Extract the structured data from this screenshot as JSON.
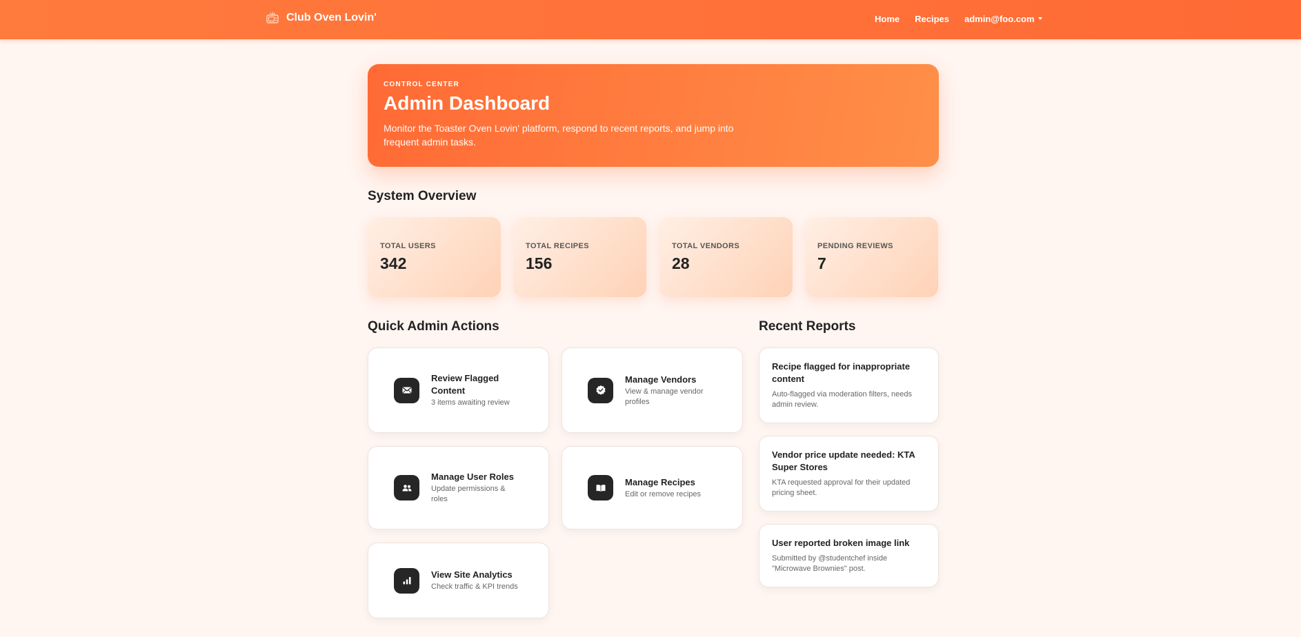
{
  "navbar": {
    "brand": "Club Oven Lovin'",
    "links": [
      "Home",
      "Recipes"
    ],
    "user": "admin@foo.com"
  },
  "hero": {
    "eyebrow": "CONTROL CENTER",
    "title": "Admin Dashboard",
    "description": "Monitor the Toaster Oven Lovin' platform, respond to recent reports, and jump into frequent admin tasks."
  },
  "overview": {
    "title": "System Overview",
    "stats": [
      {
        "label": "TOTAL USERS",
        "value": "342"
      },
      {
        "label": "TOTAL RECIPES",
        "value": "156"
      },
      {
        "label": "TOTAL VENDORS",
        "value": "28"
      },
      {
        "label": "PENDING REVIEWS",
        "value": "7"
      }
    ]
  },
  "actions": {
    "title": "Quick Admin Actions",
    "items": [
      {
        "title": "Review Flagged Content",
        "subtitle": "3 items awaiting review",
        "icon": "envelope-icon"
      },
      {
        "title": "Manage Vendors",
        "subtitle": "View & manage vendor profiles",
        "icon": "badge-check-icon"
      },
      {
        "title": "Manage User Roles",
        "subtitle": "Update permissions & roles",
        "icon": "users-icon"
      },
      {
        "title": "Manage Recipes",
        "subtitle": "Edit or remove recipes",
        "icon": "book-icon"
      },
      {
        "title": "View Site Analytics",
        "subtitle": "Check traffic & KPI trends",
        "icon": "bar-chart-icon"
      }
    ]
  },
  "reports": {
    "title": "Recent Reports",
    "items": [
      {
        "title": "Recipe flagged for inappropriate content",
        "description": "Auto-flagged via moderation filters, needs admin review."
      },
      {
        "title": "Vendor price update needed: KTA Super Stores",
        "description": "KTA requested approval for their updated pricing sheet."
      },
      {
        "title": "User reported broken image link",
        "description": "Submitted by @studentchef inside \"Microwave Brownies\" post."
      }
    ]
  },
  "colors": {
    "brand_orange": "#ff6a35",
    "background": "#fff5f1",
    "icon_tile": "#262626"
  }
}
